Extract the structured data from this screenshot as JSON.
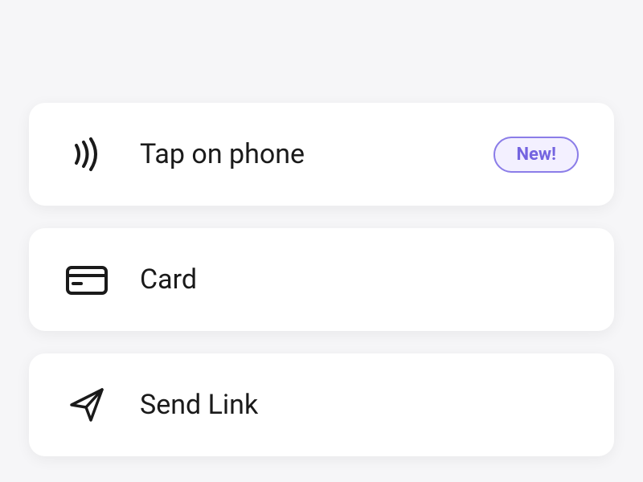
{
  "options": [
    {
      "label": "Tap on phone",
      "icon": "contactless",
      "badge": "New!"
    },
    {
      "label": "Card",
      "icon": "card"
    },
    {
      "label": "Send Link",
      "icon": "send"
    }
  ],
  "colors": {
    "badge_border": "#8b7de8",
    "badge_text": "#7464e0",
    "badge_bg": "#f3f0ff"
  }
}
